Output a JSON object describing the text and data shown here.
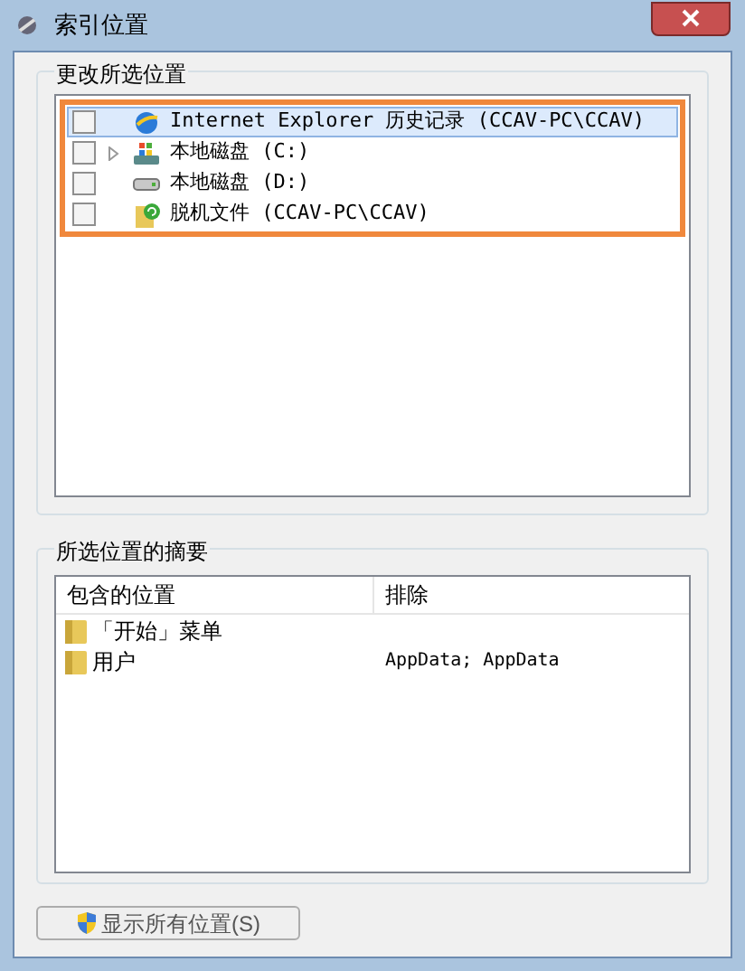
{
  "window": {
    "title": "索引位置"
  },
  "change_locations": {
    "label": "更改所选位置",
    "items": [
      {
        "kind": "browser",
        "label": "Internet Explorer 历史记录 (CCAV-PC\\CCAV)",
        "checked": false,
        "selected": true,
        "expandable": false
      },
      {
        "kind": "system-drive",
        "label": "本地磁盘 (C:)",
        "checked": false,
        "selected": false,
        "expandable": true
      },
      {
        "kind": "drive",
        "label": "本地磁盘 (D:)",
        "checked": false,
        "selected": false,
        "expandable": false
      },
      {
        "kind": "offline",
        "label": "脱机文件 (CCAV-PC\\CCAV)",
        "checked": false,
        "selected": false,
        "expandable": false
      }
    ]
  },
  "summary": {
    "label": "所选位置的摘要",
    "columns": [
      "包含的位置",
      "排除"
    ],
    "rows": [
      {
        "location": "「开始」菜单",
        "exclude": ""
      },
      {
        "location": "用户",
        "exclude": "AppData; AppData"
      }
    ]
  },
  "buttons": [
    {
      "label": "显示所有位置(S)"
    }
  ]
}
